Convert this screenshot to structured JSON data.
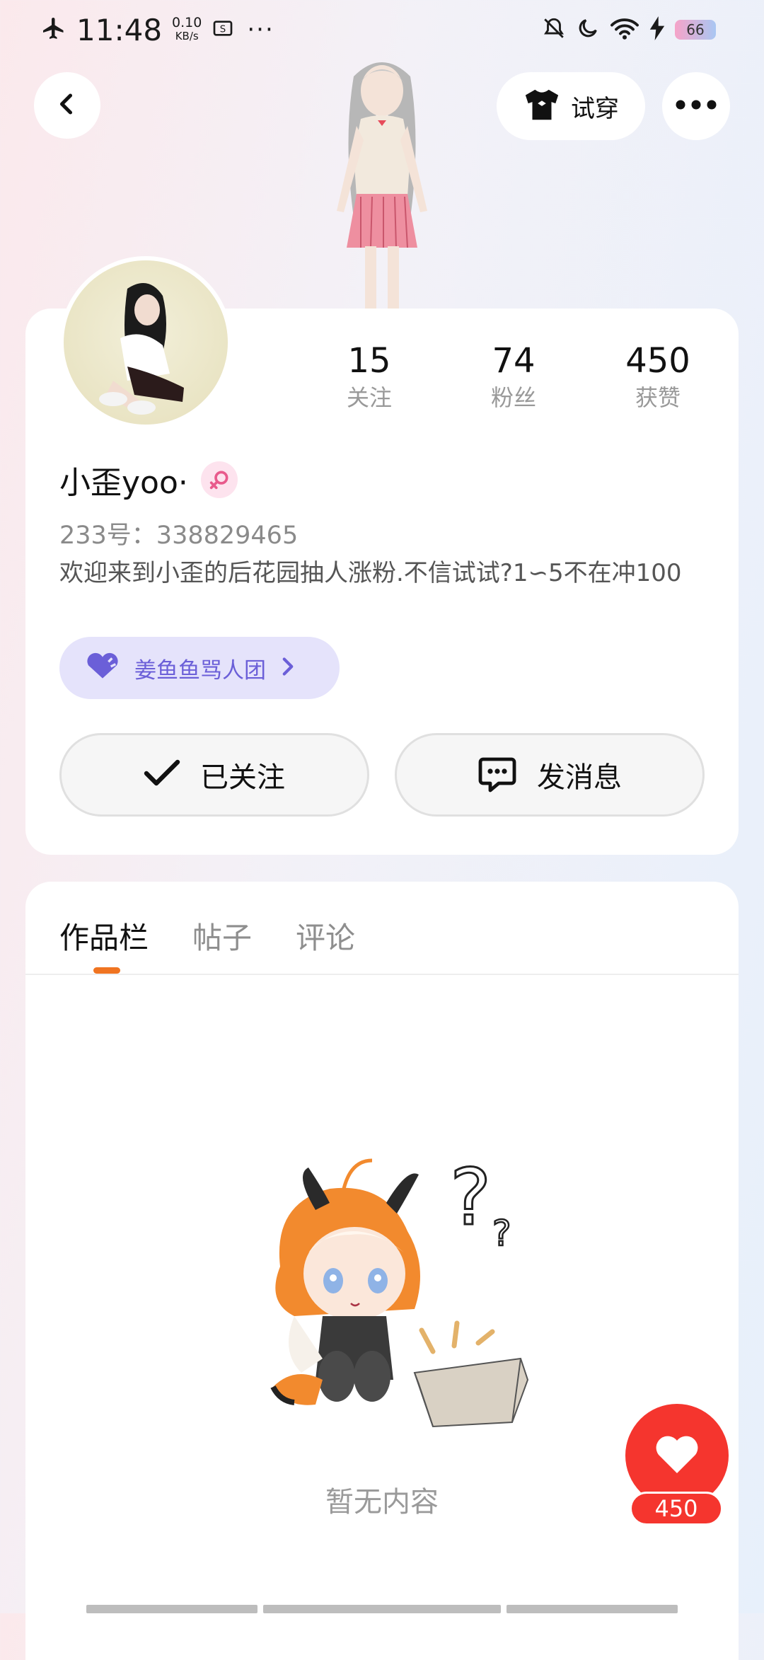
{
  "status_bar": {
    "time": "11:48",
    "net_speed": "0.10",
    "net_unit": "KB/s",
    "more": "···",
    "battery": "66"
  },
  "top_bar": {
    "try_on_label": "试穿"
  },
  "profile": {
    "stats": [
      {
        "value": "15",
        "label": "关注"
      },
      {
        "value": "74",
        "label": "粉丝"
      },
      {
        "value": "450",
        "label": "获赞"
      }
    ],
    "username": "小歪yoo·",
    "uid": "233号：338829465",
    "bio": "欢迎来到小歪的后花园抽人涨粉.不信试试?1∽5不在冲100",
    "group_label": "姜鱼鱼骂人团",
    "follow_label": "已关注",
    "message_label": "发消息"
  },
  "tabs": [
    {
      "label": "作品栏",
      "active": true
    },
    {
      "label": "帖子",
      "active": false
    },
    {
      "label": "评论",
      "active": false
    }
  ],
  "empty_state": {
    "text": "暂无内容"
  },
  "like": {
    "count": "450"
  },
  "colors": {
    "accent_orange": "#f07421",
    "like_red": "#f5352e",
    "group_purple": "#6b5fd8"
  }
}
